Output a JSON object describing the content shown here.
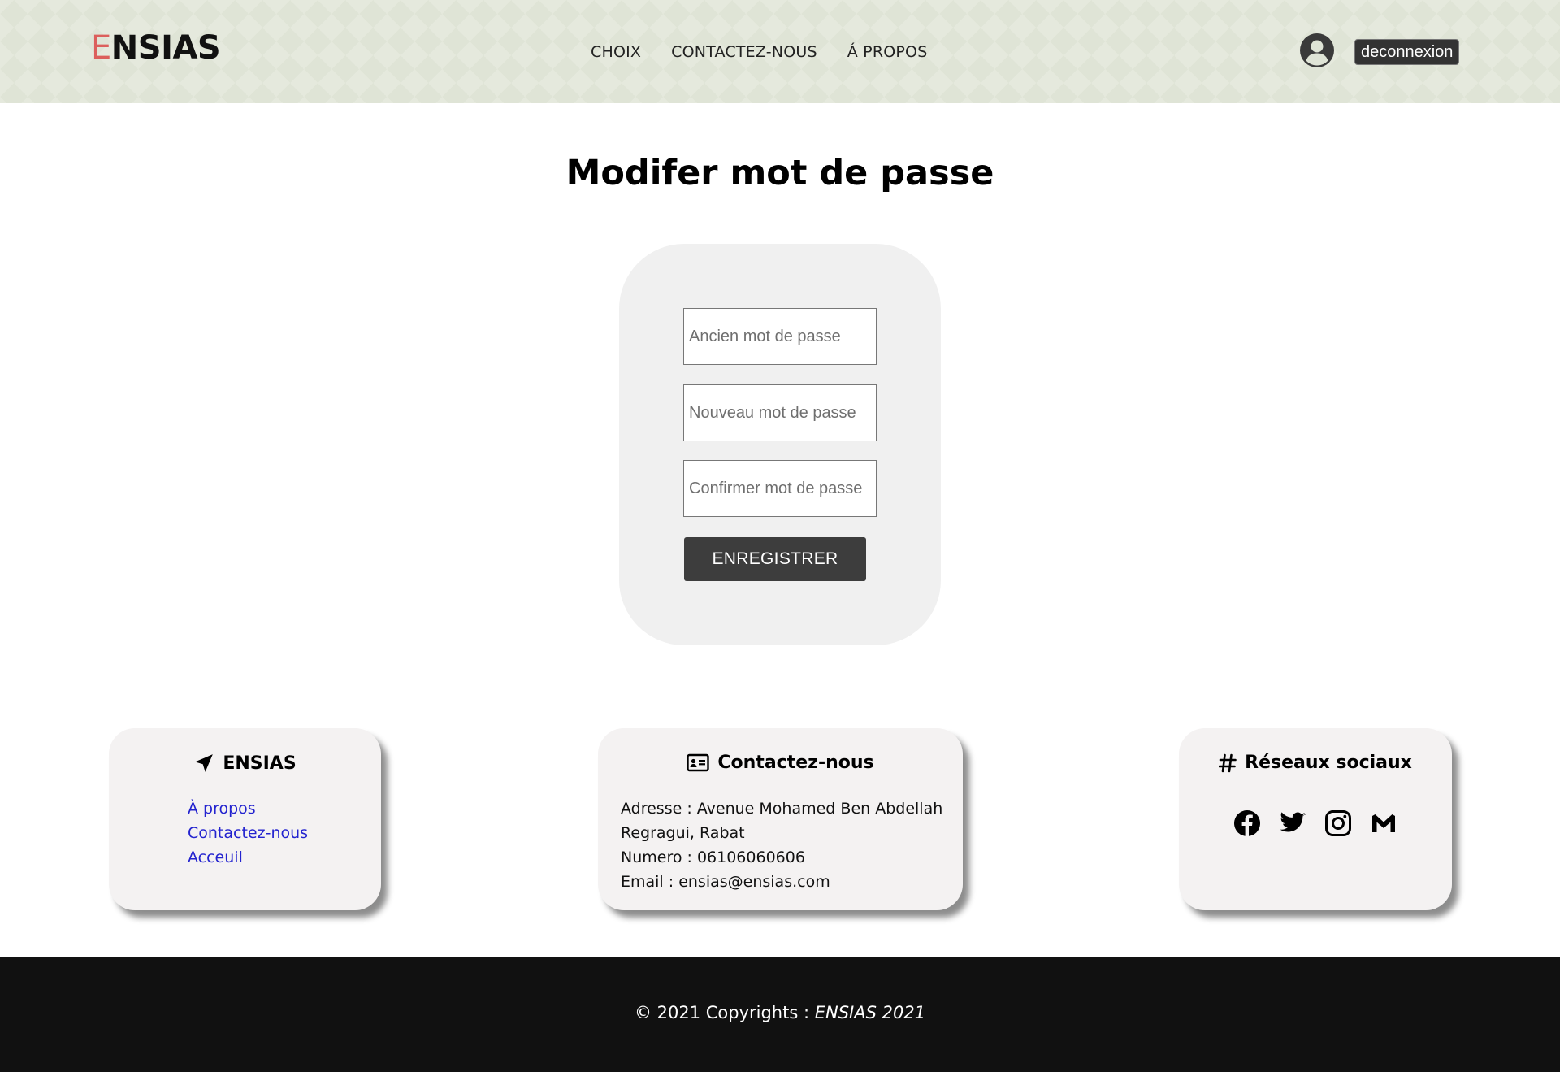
{
  "header": {
    "logo_first": "E",
    "logo_rest": "NSIAS",
    "nav": [
      "CHOIX",
      "CONTACTEZ-NOUS",
      "Á PROPOS"
    ],
    "user_icon": "user-circle-icon",
    "logout_label": "deconnexion"
  },
  "main": {
    "title": "Modifer mot de passe",
    "fields": {
      "old_placeholder": "Ancien mot de passe",
      "new_placeholder": "Nouveau mot de passe",
      "confirm_placeholder": "Confirmer mot de passe"
    },
    "save_label": "ENREGISTRER"
  },
  "cards": {
    "ensias": {
      "icon": "location-arrow-icon",
      "title": "ENSIAS",
      "links": [
        "À propos",
        "Contactez-nous",
        "Acceuil"
      ]
    },
    "contact": {
      "icon": "address-card-icon",
      "title": "Contactez-nous",
      "lines": [
        "Adresse : Avenue Mohamed Ben Abdellah",
        "Regragui, Rabat",
        "Numero : 06106060606",
        "Email : ensias@ensias.com"
      ]
    },
    "social": {
      "icon": "hashtag-icon",
      "title": "Réseaux sociaux",
      "icons": [
        "facebook-icon",
        "twitter-icon",
        "instagram-icon",
        "gmail-icon"
      ]
    }
  },
  "footer": {
    "copyright_prefix": "© 2021 Copyrights : ",
    "copyright_brand": "ENSIAS 2021"
  },
  "colors": {
    "header_bg": "#dfe4d6",
    "logo_accent": "#dc5f5c",
    "button_dark": "#3d3d3d",
    "link_blue": "#2323cf",
    "footer_bg": "#111111"
  }
}
